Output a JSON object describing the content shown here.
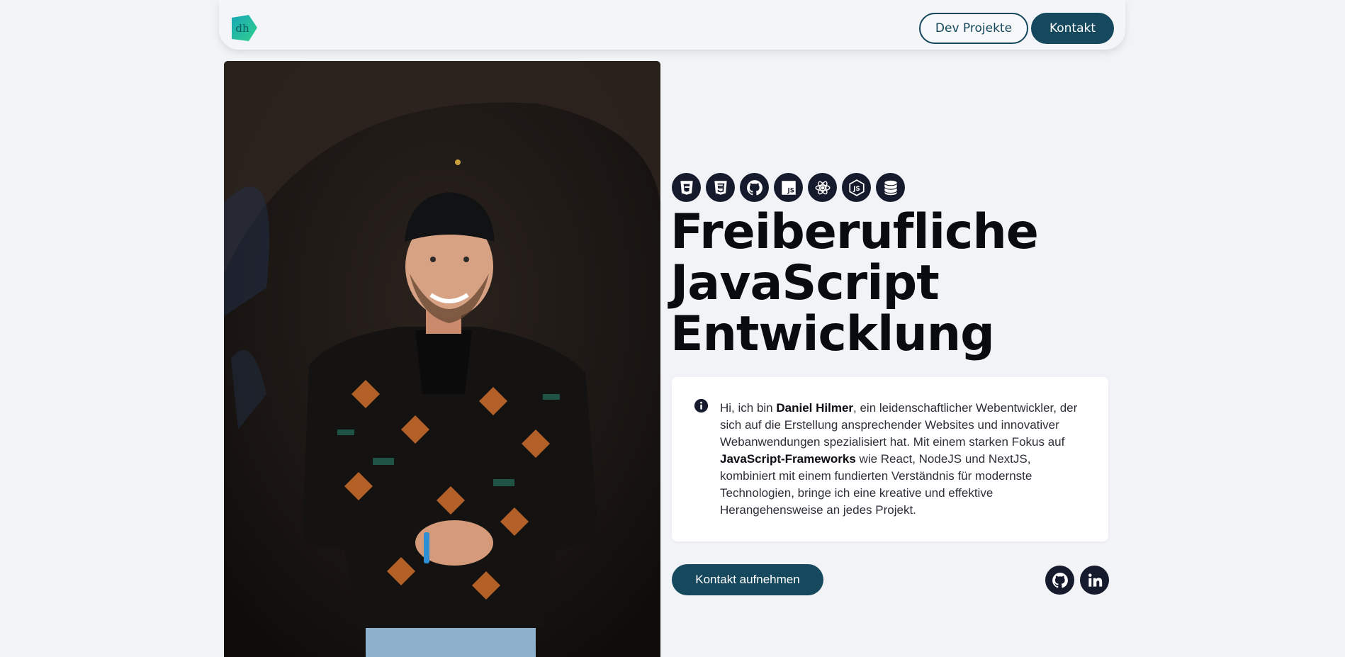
{
  "nav": {
    "logo_text": "dh",
    "projects_label": "Dev Projekte",
    "contact_label": "Kontakt"
  },
  "tech_icons": [
    "html5-icon",
    "css3-icon",
    "github-icon",
    "javascript-icon",
    "react-icon",
    "nodejs-icon",
    "database-icon"
  ],
  "hero": {
    "headline_line1": "Freiberufliche",
    "headline_line2": "JavaScript",
    "headline_line3": "Entwicklung"
  },
  "intro": {
    "part1": "Hi, ich bin ",
    "name": "Daniel Hilmer",
    "part2": ", ein leidenschaftlicher Webentwickler, der sich auf die Erstellung ansprechender Websites und innovativer Webanwendungen spezialisiert hat. Mit einem starken Fokus auf ",
    "highlight": "JavaScript-Frameworks",
    "part3": " wie React, NodeJS und NextJS, kombiniert mit einem fundierten Verständnis für modernste Technologien, bringe ich eine kreative und effektive Herangehensweise an jedes Projekt."
  },
  "cta_label": "Kontakt aufnehmen",
  "social_icons": [
    "github-icon",
    "linkedin-icon"
  ],
  "colors": {
    "background": "#f1f3f6",
    "brand": "#17495e",
    "icon_bg": "#151b2d",
    "heading": "#090b10",
    "logo_teal": "#1fb5a8"
  }
}
